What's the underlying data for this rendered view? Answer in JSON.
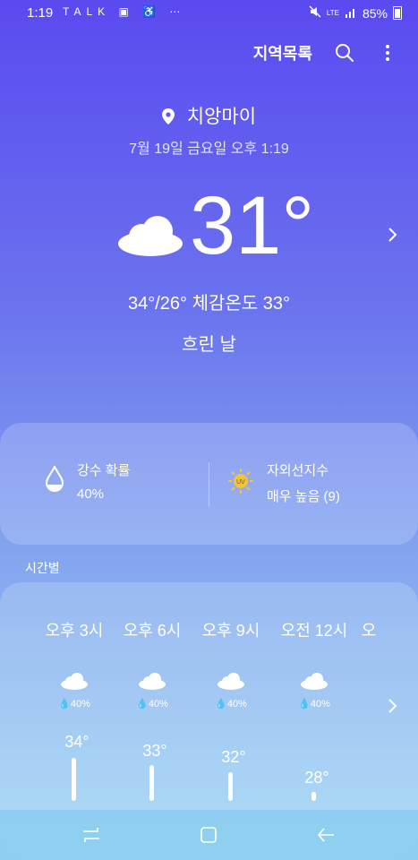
{
  "status_bar": {
    "time": "1:19",
    "notification_icons": [
      "talk-icon",
      "car-icon",
      "accessibility-icon",
      "more-dots-icon"
    ],
    "notification_glyphs": "TALK ▣ ♿ ⋯",
    "network": "LTE",
    "battery": "85%"
  },
  "header": {
    "location_list_label": "지역목록",
    "icons": [
      "search-icon",
      "more-vert-icon"
    ]
  },
  "current": {
    "location": "치앙마이",
    "datetime": "7월 19일 금요일 오후 1:19",
    "temperature": "31°",
    "minmax_feels": "34°/26° 체감온도 33°",
    "condition": "흐린 날",
    "condition_icon": "cloud-icon"
  },
  "details": {
    "precip_label": "강수 확률",
    "precip_value": "40%",
    "uv_label": "자외선지수",
    "uv_value": "매우 높음 (9)",
    "uv_badge": "UV"
  },
  "hourly": {
    "section_title": "시간별",
    "items": [
      {
        "time": "오후 3시",
        "precip": "40%",
        "temp": "34°"
      },
      {
        "time": "오후 6시",
        "precip": "40%",
        "temp": "33°"
      },
      {
        "time": "오후 9시",
        "precip": "40%",
        "temp": "32°"
      },
      {
        "time": "오전 12시",
        "precip": "40%",
        "temp": "28°"
      }
    ],
    "partial_next": "오"
  },
  "nav": {
    "icons": [
      "recent-apps-icon",
      "home-icon",
      "back-icon"
    ]
  },
  "colors": {
    "gradient_top": "#5a4af0",
    "gradient_bottom": "#9fd6f4",
    "uv_sun": "#f2c43b"
  }
}
